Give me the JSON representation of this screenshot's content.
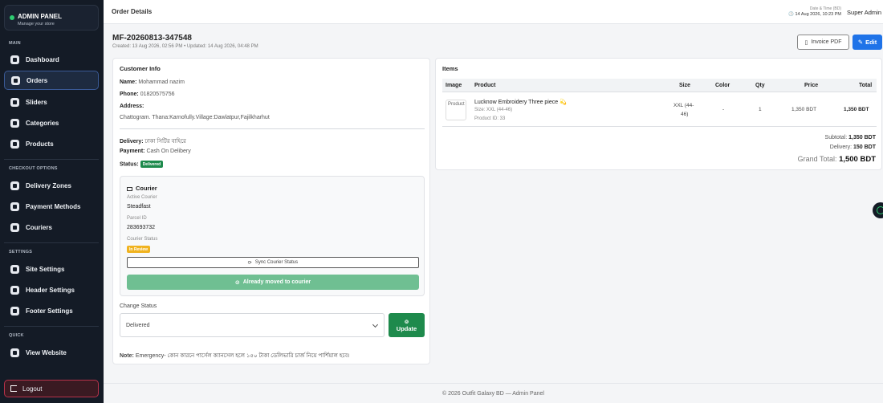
{
  "sidebar": {
    "brand_title": "ADMIN PANEL",
    "brand_sub": "Manage your store",
    "sections": {
      "main": "MAIN",
      "checkout": "CHECKOUT OPTIONS",
      "settings": "SETTINGS",
      "quick": "QUICK"
    },
    "items": [
      {
        "label": "Dashboard",
        "icon": "dashboard-icon"
      },
      {
        "label": "Orders",
        "icon": "orders-icon"
      },
      {
        "label": "Sliders",
        "icon": "sliders-icon"
      },
      {
        "label": "Categories",
        "icon": "tag-icon"
      },
      {
        "label": "Products",
        "icon": "box-icon"
      },
      {
        "label": "Delivery Zones",
        "icon": "truck-icon"
      },
      {
        "label": "Payment Methods",
        "icon": "card-icon"
      },
      {
        "label": "Couriers",
        "icon": "courier-icon"
      },
      {
        "label": "Site Settings",
        "icon": "gear-icon"
      },
      {
        "label": "Header Settings",
        "icon": "layout-icon"
      },
      {
        "label": "Footer Settings",
        "icon": "layout-icon"
      },
      {
        "label": "View Website",
        "icon": "globe-icon"
      }
    ],
    "logout": "Logout"
  },
  "topbar": {
    "title": "Order Details",
    "dt_label": "Date & Time (BD)",
    "dt_value": "14 Aug 2026, 10:23 PM",
    "user": "Super Admin"
  },
  "order": {
    "id": "MF-20260813-347548",
    "meta": "Created: 13 Aug 2026, 02:56 PM  •  Updated: 14 Aug 2026, 04:48 PM",
    "invoice_btn": "Invoice PDF",
    "edit_btn": "Edit"
  },
  "customer": {
    "title": "Customer Info",
    "name_label": "Name:",
    "name": "Mohammad nazim",
    "phone_label": "Phone:",
    "phone": "01820575756",
    "address_label": "Address:",
    "address": "Chattogram. Thana:Karnofully.Village:Dawlatpur,Fajilkharhut",
    "delivery_label": "Delivery:",
    "delivery": "ঢাকা সিটির বাহিরে",
    "payment_label": "Payment:",
    "payment": "Cash On Delibery",
    "status_label": "Status:",
    "status": "Delivered"
  },
  "courier": {
    "title": "Courier",
    "active_label": "Active Courier",
    "active": "Steadfast",
    "parcel_label": "Parcel ID",
    "parcel": "283693732",
    "status_label": "Courier Status",
    "status": "In Review",
    "sync_btn": "Sync Courier Status",
    "moved_btn": "Already moved to courier"
  },
  "change_status": {
    "label": "Change Status",
    "selected": "Delivered",
    "update_btn": "Update"
  },
  "note": {
    "label": "Note:",
    "text": "Emergency- কোন কারনে পার্সেল ক্যানসেল হলে ১৫০ টাকা ডেলিভারি চার্জ নিয়ে পার্শিয়াল হবে।"
  },
  "items": {
    "title": "Items",
    "columns": [
      "Image",
      "Product",
      "Size",
      "Color",
      "Qty",
      "Price",
      "Total"
    ],
    "rows": [
      {
        "image_alt": "Product",
        "product": "Lucknow Embroidery Three piece 💫",
        "size_sub": "Size: XXL (44-46)",
        "product_id": "Product ID: 33",
        "size_line1": "XXL (44-",
        "size_line2": "46)",
        "color": "-",
        "qty": "1",
        "price": "1,350 BDT",
        "total": "1,350 BDT"
      }
    ],
    "subtotal_label": "Subtotal:",
    "subtotal": "1,350 BDT",
    "delivery_label": "Delivery:",
    "delivery": "150 BDT",
    "grand_label": "Grand Total:",
    "grand": "1,500 BDT"
  },
  "footer": "© 2026 Outfit Galaxy BD — Admin Panel"
}
